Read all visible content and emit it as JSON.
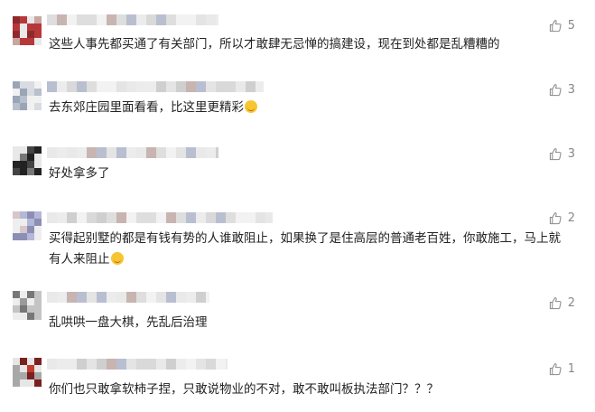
{
  "comments": [
    {
      "avatar_colors": [
        "#b7383a",
        "#8f2a2c",
        "#c9a6a0",
        "#e9e9e9"
      ],
      "text": "这些人事先都买通了有关部门，所以才敢肆无忌惮的搞建设，现在到处都是乱糟糟的",
      "likes": "5",
      "emoji": false
    },
    {
      "avatar_colors": [
        "#9aa5b5",
        "#b8c0cc",
        "#d8dce2",
        "#f1f1f1"
      ],
      "text": "去东郊庄园里面看看，比这里更精彩",
      "likes": "3",
      "emoji": true
    },
    {
      "avatar_colors": [
        "#222222",
        "#444444",
        "#777777",
        "#e8e8e8"
      ],
      "text": "好处拿多了",
      "likes": "3",
      "emoji": false
    },
    {
      "avatar_colors": [
        "#8c8fb5",
        "#b4b7d6",
        "#d9c6c8",
        "#eeeeee"
      ],
      "text": "买得起别墅的都是有钱有势的人谁敢阻止，如果换了是住高层的普通老百姓，你敢施工，马上就有人来阻止",
      "likes": "2",
      "emoji": true
    },
    {
      "avatar_colors": [
        "#777777",
        "#9a9a9a",
        "#c4c4c4",
        "#ededed"
      ],
      "text": "乱哄哄一盘大棋，先乱后治理",
      "likes": "2",
      "emoji": false
    },
    {
      "avatar_colors": [
        "#7a2020",
        "#c33b2b",
        "#a8a8a8",
        "#e6e6e6"
      ],
      "text": "你们也只敢拿软柿子捏，只敢说物业的不对，敢不敢叫板执法部门？？？",
      "likes": "1",
      "emoji": false
    }
  ]
}
